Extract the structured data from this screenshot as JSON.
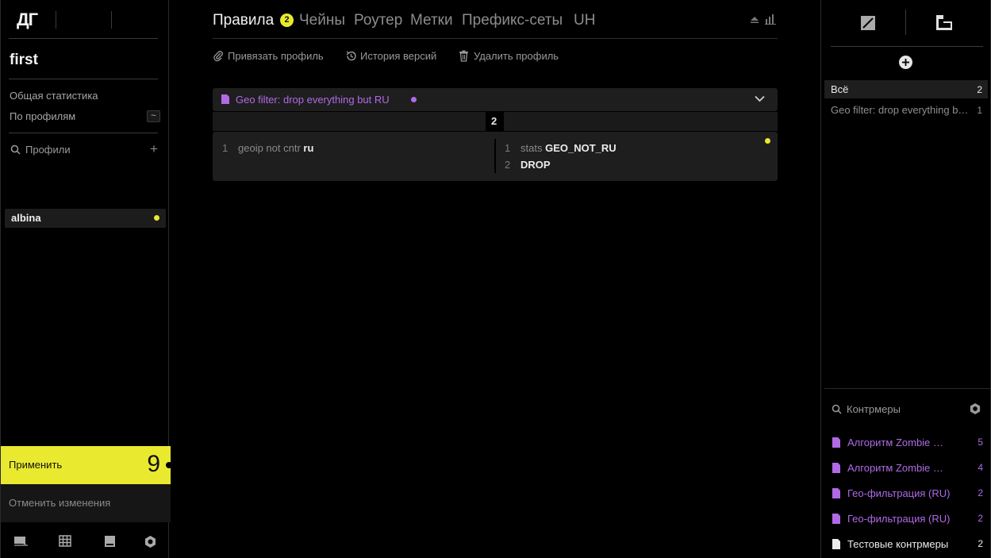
{
  "app": {
    "logo": "ДГ",
    "project": "first"
  },
  "sidebar": {
    "menu": [
      {
        "label": "Общая статистика"
      },
      {
        "label": "По профилям",
        "key": "~"
      }
    ],
    "profiles_search": "Профили",
    "add_symbol": "+",
    "profiles": [
      {
        "name": "albina",
        "status_color": "#e9ea2f"
      }
    ],
    "apply": {
      "label": "Применить",
      "count": "9"
    },
    "cancel": {
      "label": "Отменить изменения"
    },
    "bottom_icons": [
      "chat-icon",
      "grid-icon",
      "book-icon",
      "settings-icon"
    ]
  },
  "main": {
    "tabs": [
      {
        "label": "Правила",
        "active": true,
        "badge": "2"
      },
      {
        "label": "Чейны"
      },
      {
        "label": "Роутер"
      },
      {
        "label": "Метки"
      },
      {
        "label": "Префикс-сеты"
      },
      {
        "label": "UH"
      }
    ],
    "actions": [
      {
        "label": "Привязать профиль",
        "icon": "paperclip-icon"
      },
      {
        "label": "История версий",
        "icon": "history-icon"
      },
      {
        "label": "Удалить профиль",
        "icon": "trash-icon"
      }
    ],
    "rule": {
      "title": "Geo filter: drop everything but RU",
      "title_color": "#b06ae6",
      "counter": "2",
      "left_lines": [
        {
          "n": "1",
          "text": "geoip not cntr ",
          "bold": "ru"
        }
      ],
      "right_lines": [
        {
          "n": "1",
          "text": "stats ",
          "bold": "GEO_NOT_RU"
        },
        {
          "n": "2",
          "text": "",
          "bold": "DROP"
        }
      ]
    }
  },
  "right": {
    "add_symbol": "+",
    "filters": [
      {
        "label": "Всё",
        "count": "2"
      },
      {
        "label": "Geo filter: drop everything but RU",
        "count": "1"
      }
    ],
    "countermeasures_search": "Контрмеры",
    "countermeasures": [
      {
        "label": "Алгоритм Zombie Ransomware",
        "count": "5",
        "color": "#b06ae6"
      },
      {
        "label": "Алгоритм Zombie Ransomware",
        "count": "4",
        "color": "#b06ae6"
      },
      {
        "label": "Гео-фильтрация (RU)",
        "count": "2",
        "color": "#b06ae6"
      },
      {
        "label": "Гео-фильтрация (RU)",
        "count": "2",
        "color": "#b06ae6"
      },
      {
        "label": "Тестовые контрмеры",
        "count": "2",
        "color": "#ececec"
      }
    ]
  }
}
